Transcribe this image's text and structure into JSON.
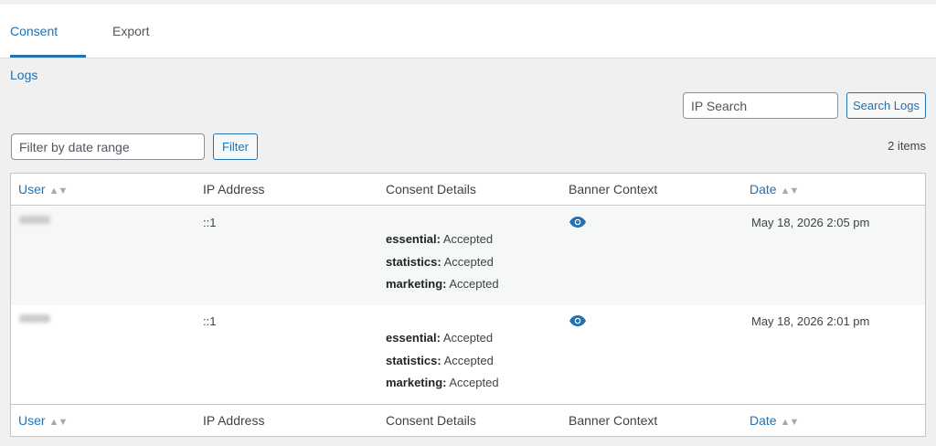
{
  "tabs": [
    {
      "label": "Consent Logs",
      "active": true
    },
    {
      "label": "Export",
      "active": false
    }
  ],
  "search": {
    "placeholder": "IP Search",
    "button_label": "Search Logs"
  },
  "filter": {
    "placeholder": "Filter by date range",
    "button_label": "Filter"
  },
  "items_count": "2 items",
  "table": {
    "columns": [
      "User",
      "IP Address",
      "Consent Details",
      "Banner Context",
      "Date"
    ],
    "sortable_columns": [
      "User",
      "Date"
    ],
    "rows": [
      {
        "ip": "::1",
        "details": [
          {
            "key": "essential:",
            "value": " Accepted"
          },
          {
            "key": "statistics:",
            "value": " Accepted"
          },
          {
            "key": "marketing:",
            "value": " Accepted"
          }
        ],
        "banner_icon": "eye-icon",
        "date": "May 18, 2026 2:05 pm"
      },
      {
        "ip": "::1",
        "details": [
          {
            "key": "essential:",
            "value": " Accepted"
          },
          {
            "key": "statistics:",
            "value": " Accepted"
          },
          {
            "key": "marketing:",
            "value": " Accepted"
          }
        ],
        "banner_icon": "eye-icon",
        "date": "May 18, 2026 2:01 pm"
      }
    ]
  },
  "colors": {
    "accent": "#2271b1",
    "background": "#f0f0f1",
    "text": "#3c434a"
  }
}
